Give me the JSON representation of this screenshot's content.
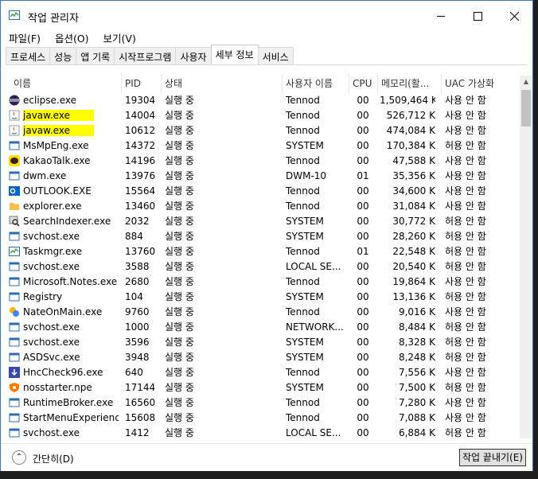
{
  "window": {
    "title": "작업 관리자"
  },
  "menu": [
    "파일(F)",
    "옵션(O)",
    "보기(V)"
  ],
  "tabs": [
    "프로세스",
    "성능",
    "앱 기록",
    "시작프로그램",
    "사용자",
    "세부 정보",
    "서비스"
  ],
  "active_tab": "세부 정보",
  "columns": [
    "이름",
    "PID",
    "상태",
    "사용자 이름",
    "CPU",
    "메모리(활...",
    "UAC 가상화"
  ],
  "rows": [
    {
      "name": "eclipse.exe",
      "pid": "19304",
      "status": "실행 중",
      "user": "Tennod",
      "cpu": "00",
      "mem": "1,509,464 K",
      "uac": "사용 안 함",
      "icon": "eclipse-icon",
      "highlight": false
    },
    {
      "name": "javaw.exe",
      "pid": "14004",
      "status": "실행 중",
      "user": "Tennod",
      "cpu": "00",
      "mem": "526,712 K",
      "uac": "사용 안 함",
      "icon": "java-icon",
      "highlight": true
    },
    {
      "name": "javaw.exe",
      "pid": "10612",
      "status": "실행 중",
      "user": "Tennod",
      "cpu": "00",
      "mem": "474,084 K",
      "uac": "사용 안 함",
      "icon": "java-icon",
      "highlight": true
    },
    {
      "name": "MsMpEng.exe",
      "pid": "14372",
      "status": "실행 중",
      "user": "SYSTEM",
      "cpu": "00",
      "mem": "170,384 K",
      "uac": "허용 안 함",
      "icon": "window-icon",
      "highlight": false
    },
    {
      "name": "KakaoTalk.exe",
      "pid": "14196",
      "status": "실행 중",
      "user": "Tennod",
      "cpu": "00",
      "mem": "47,588 K",
      "uac": "사용 안 함",
      "icon": "kakao-icon",
      "highlight": false
    },
    {
      "name": "dwm.exe",
      "pid": "13976",
      "status": "실행 중",
      "user": "DWM-10",
      "cpu": "01",
      "mem": "35,356 K",
      "uac": "사용 안 함",
      "icon": "window-icon",
      "highlight": false
    },
    {
      "name": "OUTLOOK.EXE",
      "pid": "15564",
      "status": "실행 중",
      "user": "Tennod",
      "cpu": "00",
      "mem": "34,600 K",
      "uac": "사용 안 함",
      "icon": "outlook-icon",
      "highlight": false
    },
    {
      "name": "explorer.exe",
      "pid": "13460",
      "status": "실행 중",
      "user": "Tennod",
      "cpu": "00",
      "mem": "31,084 K",
      "uac": "사용 안 함",
      "icon": "folder-icon",
      "highlight": false
    },
    {
      "name": "SearchIndexer.exe",
      "pid": "2032",
      "status": "실행 중",
      "user": "SYSTEM",
      "cpu": "00",
      "mem": "30,772 K",
      "uac": "허용 안 함",
      "icon": "search-indexer-icon",
      "highlight": false
    },
    {
      "name": "svchost.exe",
      "pid": "884",
      "status": "실행 중",
      "user": "SYSTEM",
      "cpu": "00",
      "mem": "28,260 K",
      "uac": "허용 안 함",
      "icon": "window-icon",
      "highlight": false
    },
    {
      "name": "Taskmgr.exe",
      "pid": "13760",
      "status": "실행 중",
      "user": "Tennod",
      "cpu": "01",
      "mem": "22,548 K",
      "uac": "허용 안 함",
      "icon": "taskmgr-icon",
      "highlight": false
    },
    {
      "name": "svchost.exe",
      "pid": "3588",
      "status": "실행 중",
      "user": "LOCAL SE...",
      "cpu": "00",
      "mem": "20,540 K",
      "uac": "허용 안 함",
      "icon": "window-icon",
      "highlight": false
    },
    {
      "name": "Microsoft.Notes.exe",
      "pid": "2680",
      "status": "실행 중",
      "user": "Tennod",
      "cpu": "00",
      "mem": "19,864 K",
      "uac": "사용 안 함",
      "icon": "window-icon",
      "highlight": false
    },
    {
      "name": "Registry",
      "pid": "104",
      "status": "실행 중",
      "user": "SYSTEM",
      "cpu": "00",
      "mem": "13,136 K",
      "uac": "허용 안 함",
      "icon": "window-icon",
      "highlight": false
    },
    {
      "name": "NateOnMain.exe",
      "pid": "9760",
      "status": "실행 중",
      "user": "Tennod",
      "cpu": "00",
      "mem": "9,016 K",
      "uac": "사용 안 함",
      "icon": "nateon-icon",
      "highlight": false
    },
    {
      "name": "svchost.exe",
      "pid": "1000",
      "status": "실행 중",
      "user": "NETWORK...",
      "cpu": "00",
      "mem": "8,484 K",
      "uac": "허용 안 함",
      "icon": "window-icon",
      "highlight": false
    },
    {
      "name": "svchost.exe",
      "pid": "3596",
      "status": "실행 중",
      "user": "SYSTEM",
      "cpu": "00",
      "mem": "8,328 K",
      "uac": "허용 안 함",
      "icon": "window-icon",
      "highlight": false
    },
    {
      "name": "ASDSvc.exe",
      "pid": "3948",
      "status": "실행 중",
      "user": "SYSTEM",
      "cpu": "00",
      "mem": "8,248 K",
      "uac": "허용 안 함",
      "icon": "window-icon",
      "highlight": false
    },
    {
      "name": "HncCheck96.exe",
      "pid": "640",
      "status": "실행 중",
      "user": "Tennod",
      "cpu": "00",
      "mem": "7,556 K",
      "uac": "사용 안 함",
      "icon": "download-icon",
      "highlight": false
    },
    {
      "name": "nosstarter.npe",
      "pid": "17144",
      "status": "실행 중",
      "user": "SYSTEM",
      "cpu": "00",
      "mem": "7,500 K",
      "uac": "허용 안 함",
      "icon": "shield-icon",
      "highlight": false
    },
    {
      "name": "RuntimeBroker.exe",
      "pid": "16560",
      "status": "실행 중",
      "user": "Tennod",
      "cpu": "00",
      "mem": "7,280 K",
      "uac": "사용 안 함",
      "icon": "window-icon",
      "highlight": false
    },
    {
      "name": "StartMenuExperienc...",
      "pid": "15608",
      "status": "실행 중",
      "user": "Tennod",
      "cpu": "00",
      "mem": "7,088 K",
      "uac": "사용 안 함",
      "icon": "window-icon",
      "highlight": false
    },
    {
      "name": "svchost.exe",
      "pid": "1412",
      "status": "실행 중",
      "user": "LOCAL SE...",
      "cpu": "00",
      "mem": "6,884 K",
      "uac": "허용 안 함",
      "icon": "window-icon",
      "highlight": false
    }
  ],
  "footer": {
    "less_details": "간단히(D)",
    "end_task": "작업 끝내기(E)"
  },
  "colors": {
    "highlight": "#ffff00",
    "accent": "#3a73c5"
  }
}
